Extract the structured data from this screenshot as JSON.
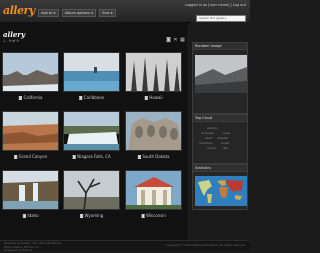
{
  "app": {
    "logo": "allery"
  },
  "nav": {
    "items": [
      "Add to",
      "Album options",
      "Sort"
    ]
  },
  "header": {
    "logged_in": "Logged in as [user name] | Log out"
  },
  "search": {
    "placeholder": "Search the gallery"
  },
  "page": {
    "title": "allery",
    "pagination": "1 - 9 of 9"
  },
  "photos": [
    {
      "label": "California"
    },
    {
      "label": "Caribbean"
    },
    {
      "label": "Hawaii"
    },
    {
      "label": "Grand Canyon"
    },
    {
      "label": "Niagara Falls, CA"
    },
    {
      "label": "South Dakota"
    },
    {
      "label": "Idaho"
    },
    {
      "label": "Wyoming"
    },
    {
      "label": "Wisconsin"
    }
  ],
  "sidebar": {
    "random": {
      "title": "Random Image"
    },
    "tags": {
      "title": "Tag Cloud",
      "items": [
        "vacation",
        "landscape",
        "travel",
        "beach",
        "waterfall",
        "mountains",
        "sunset",
        "canyon",
        "lake"
      ]
    },
    "map": {
      "title": "Statistics"
    }
  },
  "footer": {
    "left_line1": "Powered by Gallery 3.0 | RSS | Bookmark",
    "left_line2": "Photo Gallery Theme 1.0",
    "left_line3": "Designed by Ellipsis",
    "right": "Copyright © 2010 Ellipsis Interactive. All rights reserved."
  }
}
